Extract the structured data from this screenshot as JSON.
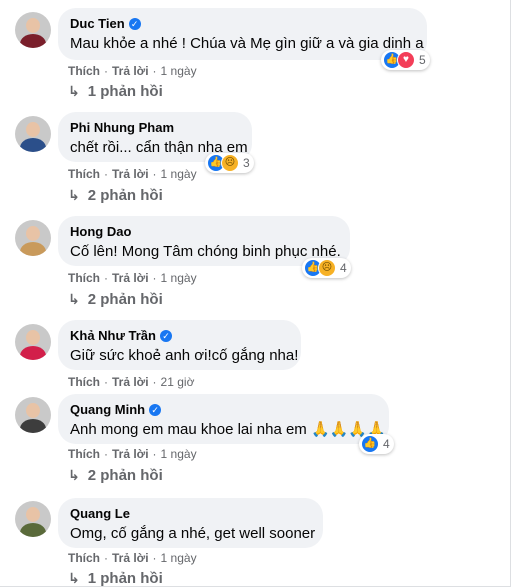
{
  "comments": [
    {
      "name": "Duc Tien",
      "verified": true,
      "text": "Mau khỏe a nhé ! Chúa và Mẹ gìn giữ a và gia dinh a",
      "reactions": [
        "like",
        "love"
      ],
      "reaction_count": "5",
      "like_label": "Thích",
      "reply_label": "Trả lời",
      "time": "1 ngày",
      "replies": "1 phản hồi",
      "avatar_color": "#7a1f2b"
    },
    {
      "name": "Phi Nhung Pham",
      "verified": false,
      "text": "chết rồi... cẩn thận nha em",
      "reactions": [
        "like",
        "sad"
      ],
      "reaction_count": "3",
      "like_label": "Thích",
      "reply_label": "Trả lời",
      "time": "1 ngày",
      "replies": "2 phản hồi",
      "avatar_color": "#2b4f8a"
    },
    {
      "name": "Hong Dao",
      "verified": false,
      "text": "Cố lên! Mong Tâm chóng binh phục nhé.",
      "reactions": [
        "like",
        "sad"
      ],
      "reaction_count": "4",
      "like_label": "Thích",
      "reply_label": "Trả lời",
      "time": "1 ngày",
      "replies": "2 phản hồi",
      "avatar_color": "#c99a5b"
    },
    {
      "name": "Khả Như Trần",
      "verified": true,
      "text": "Giữ sức khoẻ anh ơi!cố gắng nha!",
      "reactions": [],
      "reaction_count": "",
      "like_label": "Thích",
      "reply_label": "Trả lời",
      "time": "21 giờ",
      "replies": "",
      "avatar_color": "#d21f4a"
    },
    {
      "name": "Quang Minh",
      "verified": true,
      "text": "Anh mong em mau khoe lai nha em 🙏🙏🙏🙏",
      "reactions": [
        "like"
      ],
      "reaction_count": "4",
      "like_label": "Thích",
      "reply_label": "Trả lời",
      "time": "1 ngày",
      "replies": "2 phản hồi",
      "avatar_color": "#3d3d3d"
    },
    {
      "name": "Quang Le",
      "verified": false,
      "text": "Omg, cố gắng a nhé, get well sooner",
      "reactions": [],
      "reaction_count": "",
      "like_label": "Thích",
      "reply_label": "Trả lời",
      "time": "1 ngày",
      "replies": "1 phản hồi",
      "avatar_color": "#5a6a3a"
    }
  ],
  "separator": "·"
}
